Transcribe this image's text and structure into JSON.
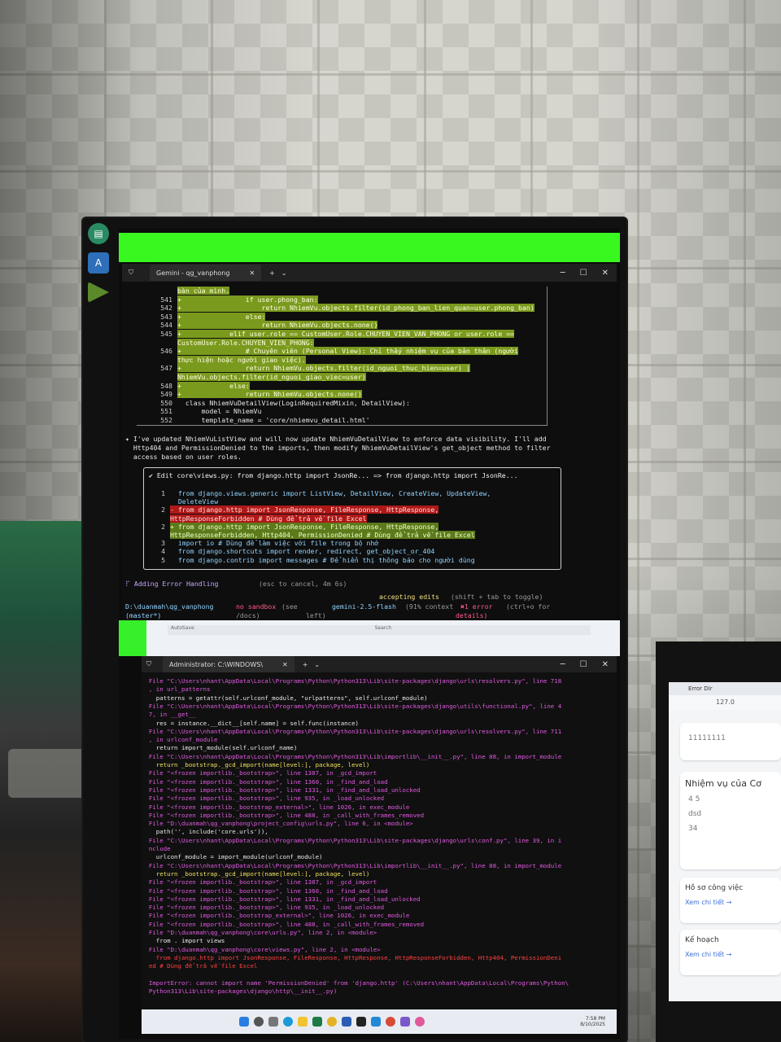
{
  "terminal_top": {
    "tab_title": "Gemini - qg_vanphong",
    "diff_lines": [
      {
        "num": "",
        "kind": "add",
        "text": "bàn của mình."
      },
      {
        "num": "541",
        "kind": "add",
        "text": "+                if user.phong_ban:"
      },
      {
        "num": "542",
        "kind": "add",
        "text": "+                    return NhiemVu.objects.filter(id_phong_ban_lien_quan=user.phong_ban)"
      },
      {
        "num": "543",
        "kind": "add",
        "text": "+                else:"
      },
      {
        "num": "544",
        "kind": "add",
        "text": "+                    return NhiemVu.objects.none()"
      },
      {
        "num": "545",
        "kind": "add",
        "text": "+            elif user.role == CustomUser.Role.CHUYEN_VIEN_VAN_PHONG or user.role =="
      },
      {
        "num": "",
        "kind": "add",
        "text": "CustomUser.Role.CHUYEN_VIEN_PHONG:"
      },
      {
        "num": "546",
        "kind": "add",
        "text": "+                # Chuyên viên (Personal View): Chỉ thấy nhiệm vụ của bản thân (người"
      },
      {
        "num": "",
        "kind": "add",
        "text": "thực hiện hoặc người giao việc)."
      },
      {
        "num": "547",
        "kind": "add",
        "text": "+                return NhiemVu.objects.filter(id_nguoi_thuc_hien=user) |"
      },
      {
        "num": "",
        "kind": "add",
        "text": "NhiemVu.objects.filter(id_nguoi_giao_viec=user)"
      },
      {
        "num": "548",
        "kind": "add",
        "text": "+            else:"
      },
      {
        "num": "549",
        "kind": "add",
        "text": "+                return NhiemVu.objects.none()"
      },
      {
        "num": "550",
        "kind": "ctx",
        "text": "  class NhiemVuDetailView(LoginRequiredMixin, DetailView):"
      },
      {
        "num": "551",
        "kind": "ctx",
        "text": "      model = NhiemVu"
      },
      {
        "num": "552",
        "kind": "ctx",
        "text": "      template_name = 'core/nhiemvu_detail.html'"
      }
    ],
    "message": "✦ I've updated NhiemVuListView and will now update NhiemVuDetailView to enforce data visibility. I'll add\n  Http404 and PermissionDenied to the imports, then modify NhiemVuDetailView's get_object method to filter\n  access based on user roles.",
    "edit_header": "✔ Edit core\\views.py: from django.http import JsonRe... => from django.http import JsonRe...",
    "edit_lines": [
      {
        "num": "1",
        "kind": "ctx",
        "text": "  from django.views.generic import ListView, DetailView, CreateView, UpdateView,"
      },
      {
        "num": "",
        "kind": "ctx",
        "text": "  DeleteView"
      },
      {
        "num": "2",
        "kind": "del",
        "text": "- from django.http import JsonResponse, FileResponse, HttpResponse,"
      },
      {
        "num": "",
        "kind": "del",
        "text": "HttpResponseForbidden # Dùng để trả về file Excel"
      },
      {
        "num": "2",
        "kind": "add",
        "text": "+ from django.http import JsonResponse, FileResponse, HttpResponse,"
      },
      {
        "num": "",
        "kind": "add",
        "text": "HttpResponseForbidden, Http404, PermissionDenied # Dùng để trả về file Excel"
      },
      {
        "num": "3",
        "kind": "ctx",
        "text": "  import io # Dùng để làm việc với file trong bộ nhớ"
      },
      {
        "num": "4",
        "kind": "ctx",
        "text": "  from django.shortcuts import render, redirect, get_object_or_404"
      },
      {
        "num": "5",
        "kind": "ctx",
        "text": "  from django.contrib import messages # Để hiển thị thông báo cho người dùng"
      }
    ],
    "spinner": "⠏ Adding Error Handling",
    "spinner_hint": "(esc to cancel, 4m 6s)",
    "accept": "accepting edits",
    "accept_hint": "(shift + tab to toggle)",
    "path": "D:\\duanmah\\qg_vanphong",
    "branch": "(master*)",
    "sandbox": "no sandbox",
    "sandbox_hint": "(see",
    "sandbox_hint2": "/docs)",
    "model": "gemini-2.5-flash",
    "context": "(91% context",
    "context2": "left)",
    "errors": "✖1 error",
    "errors_hint": "(ctrl+o for",
    "errors_hint2": "details)"
  },
  "terminal_bottom": {
    "tab_title": "Administrator: C:\\WINDOWS\\",
    "lines": [
      {
        "c": "pk",
        "t": "  File \"C:\\Users\\nhant\\AppData\\Local\\Programs\\Python\\Python313\\Lib\\site-packages\\django\\urls\\resolvers.py\", line 718"
      },
      {
        "c": "pk",
        "t": "  , in url_patterns"
      },
      {
        "c": "w",
        "t": "    patterns = getattr(self.urlconf_module, \"urlpatterns\", self.urlconf_module)"
      },
      {
        "c": "pk",
        "t": "  File \"C:\\Users\\nhant\\AppData\\Local\\Programs\\Python\\Python313\\Lib\\site-packages\\django\\utils\\functional.py\", line 4"
      },
      {
        "c": "pk",
        "t": "  7, in __get__"
      },
      {
        "c": "w",
        "t": "    res = instance.__dict__[self.name] = self.func(instance)"
      },
      {
        "c": "pk",
        "t": "  File \"C:\\Users\\nhant\\AppData\\Local\\Programs\\Python\\Python313\\Lib\\site-packages\\django\\urls\\resolvers.py\", line 711"
      },
      {
        "c": "pk",
        "t": "  , in urlconf_module"
      },
      {
        "c": "w",
        "t": "    return import_module(self.urlconf_name)"
      },
      {
        "c": "pk",
        "t": "  File \"C:\\Users\\nhant\\AppData\\Local\\Programs\\Python\\Python313\\Lib\\importlib\\__init__.py\", line 88, in import_module"
      },
      {
        "c": "yl",
        "t": "    return _bootstrap._gcd_import(name[level:], package, level)"
      },
      {
        "c": "pk",
        "t": "  File \"<frozen importlib._bootstrap>\", line 1387, in _gcd_import"
      },
      {
        "c": "pk",
        "t": "  File \"<frozen importlib._bootstrap>\", line 1360, in _find_and_load"
      },
      {
        "c": "pk",
        "t": "  File \"<frozen importlib._bootstrap>\", line 1331, in _find_and_load_unlocked"
      },
      {
        "c": "pk",
        "t": "  File \"<frozen importlib._bootstrap>\", line 935, in _load_unlocked"
      },
      {
        "c": "pk",
        "t": "  File \"<frozen importlib._bootstrap_external>\", line 1026, in exec_module"
      },
      {
        "c": "pk",
        "t": "  File \"<frozen importlib._bootstrap>\", line 488, in _call_with_frames_removed"
      },
      {
        "c": "pk",
        "t": "  File \"D:\\duanmah\\qg_vanphong\\project_config\\urls.py\", line 6, in <module>"
      },
      {
        "c": "w",
        "t": "    path('', include('core.urls')),"
      },
      {
        "c": "pk",
        "t": "  File \"C:\\Users\\nhant\\AppData\\Local\\Programs\\Python\\Python313\\Lib\\site-packages\\django\\urls\\conf.py\", line 39, in i"
      },
      {
        "c": "pk",
        "t": "  nclude"
      },
      {
        "c": "w",
        "t": "    urlconf_module = import_module(urlconf_module)"
      },
      {
        "c": "pk",
        "t": "  File \"C:\\Users\\nhant\\AppData\\Local\\Programs\\Python\\Python313\\Lib\\importlib\\__init__.py\", line 88, in import_module"
      },
      {
        "c": "yl",
        "t": "    return _bootstrap._gcd_import(name[level:], package, level)"
      },
      {
        "c": "pk",
        "t": "  File \"<frozen importlib._bootstrap>\", line 1387, in _gcd_import"
      },
      {
        "c": "pk",
        "t": "  File \"<frozen importlib._bootstrap>\", line 1360, in _find_and_load"
      },
      {
        "c": "pk",
        "t": "  File \"<frozen importlib._bootstrap>\", line 1331, in _find_and_load_unlocked"
      },
      {
        "c": "pk",
        "t": "  File \"<frozen importlib._bootstrap>\", line 935, in _load_unlocked"
      },
      {
        "c": "pk",
        "t": "  File \"<frozen importlib._bootstrap_external>\", line 1026, in exec_module"
      },
      {
        "c": "pk",
        "t": "  File \"<frozen importlib._bootstrap>\", line 488, in _call_with_frames_removed"
      },
      {
        "c": "pk",
        "t": "  File \"D:\\duanmah\\qg_vanphong\\core\\urls.py\", line 2, in <module>"
      },
      {
        "c": "w",
        "t": "    from . import views"
      },
      {
        "c": "pk",
        "t": "  File \"D:\\duanmah\\qg_vanphong\\core\\views.py\", line 2, in <module>"
      },
      {
        "c": "rd",
        "t": "    from django.http import JsonResponse, FileResponse, HttpResponse, HttpResponseForbidden, Http404, PermissionDeni"
      },
      {
        "c": "rd",
        "t": "  ed # Dùng để trả về file Excel"
      },
      {
        "c": "w",
        "t": "  "
      },
      {
        "c": "pk",
        "t": "  ImportError: cannot import name 'PermissionDenied' from 'django.http' (C:\\Users\\nhant\\AppData\\Local\\Programs\\Python\\"
      },
      {
        "c": "pk",
        "t": "  Python313\\Lib\\site-packages\\django\\http\\__init__.py)"
      }
    ],
    "clock_time": "7:58 PM",
    "clock_date": "8/10/2025"
  },
  "word_window": {
    "autosave": "AutoSave",
    "search": "Search"
  },
  "browser_right": {
    "tab": "Error Dir",
    "address": "127.0",
    "value_top": "11111111",
    "card1_title": "Nhiệm vụ của Cơ",
    "card1_values": [
      "4 5",
      "dsd",
      "34"
    ],
    "card2_title": "Hồ sơ công việc",
    "card2_link": "Xem chi tiết →",
    "card3_title": "Kế hoạch",
    "card3_link": "Xem chi tiết →"
  }
}
